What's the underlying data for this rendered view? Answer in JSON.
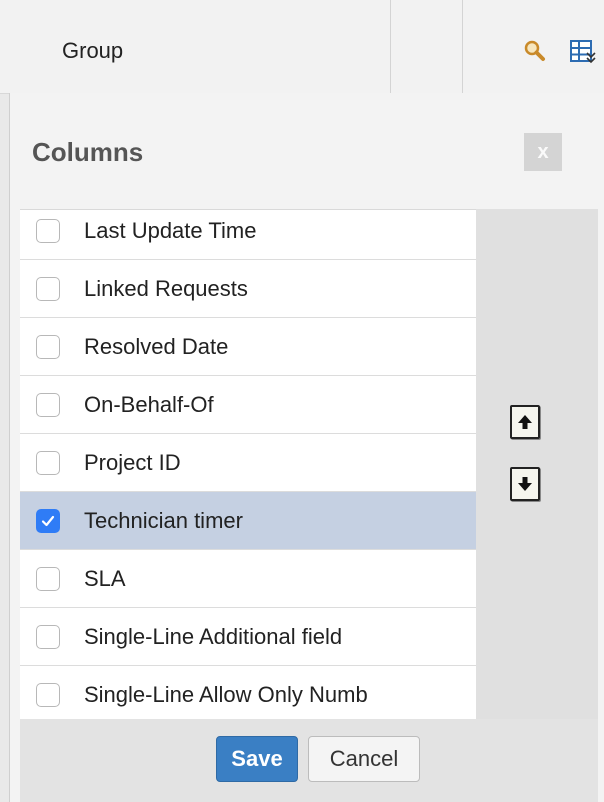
{
  "header": {
    "group_label": "Group",
    "icons": [
      "search-icon",
      "column-chooser-icon"
    ]
  },
  "popup": {
    "title": "Columns",
    "close_label": "x",
    "items": [
      {
        "label": "Last Update Time",
        "checked": false
      },
      {
        "label": "Linked Requests",
        "checked": false
      },
      {
        "label": "Resolved Date",
        "checked": false
      },
      {
        "label": "On-Behalf-Of",
        "checked": false
      },
      {
        "label": "Project ID",
        "checked": false
      },
      {
        "label": "Technician timer",
        "checked": true
      },
      {
        "label": "SLA",
        "checked": false
      },
      {
        "label": "Single-Line Additional field",
        "checked": false
      },
      {
        "label": "Single-Line Allow Only Numb",
        "checked": false
      }
    ],
    "move_icons": [
      "arrow-up-icon",
      "arrow-down-icon"
    ],
    "save_label": "Save",
    "cancel_label": "Cancel"
  },
  "colors": {
    "selected_row": "#c5d0e2",
    "checkbox_checked": "#2f7cf6",
    "save_button": "#3a7fc4"
  }
}
